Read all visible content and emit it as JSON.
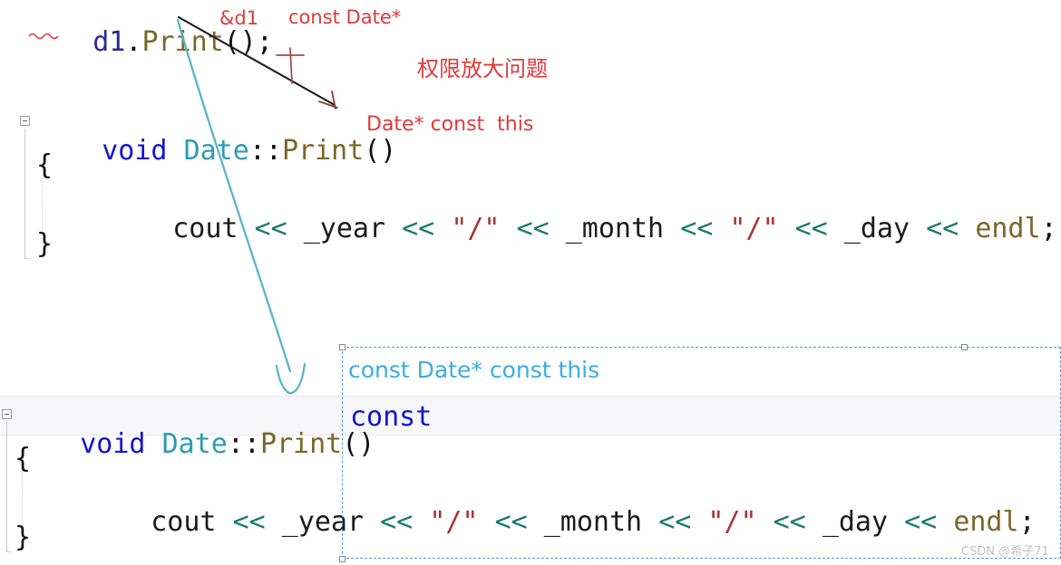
{
  "watermark": {
    "text": "CSDN @希子71"
  },
  "annotations": {
    "call_arg": "&d1",
    "call_arg_type": "const Date*",
    "this_type_nonconst": "Date* const  this",
    "this_type_const": "const Date* const this",
    "chinese_note": "权限放大问题",
    "const_keyword": "const"
  },
  "snippet_call": {
    "line": "d1.Print();",
    "tokens": {
      "object": "d1",
      "dot": ".",
      "method": "Print",
      "parens": "()",
      "semicolon": ";"
    }
  },
  "snippet_top": {
    "signature": {
      "return_type": "void",
      "class_name": "Date",
      "scope": "::",
      "method": "Print",
      "parens": "()"
    },
    "brace_open": "{",
    "body": {
      "stream": "cout",
      "op": "<<",
      "year": "_year",
      "slash": "\"/\"",
      "month": "_month",
      "day": "_day",
      "endl": "endl",
      "semicolon": ";"
    },
    "brace_close": "}"
  },
  "snippet_bottom": {
    "signature": {
      "return_type": "void",
      "class_name": "Date",
      "scope": "::",
      "method": "Print",
      "parens": "()",
      "qualifier": "const"
    },
    "brace_open": "{",
    "body": {
      "stream": "cout",
      "op": "<<",
      "year": "_year",
      "slash": "\"/\"",
      "month": "_month",
      "day": "_day",
      "endl": "endl",
      "semicolon": ";"
    },
    "brace_close": "}"
  },
  "colors": {
    "keyword": "#1414d2",
    "type": "#2e9bb5",
    "function": "#7a6829",
    "string": "#b03030",
    "operator": "#1a7a6e",
    "annotation_red": "#e03a3a",
    "annotation_cyan": "#3aaee0",
    "selection_border": "#5b9bd5",
    "arrow_blue": "#56b7c8",
    "arrow_black": "#1a1a1a"
  }
}
